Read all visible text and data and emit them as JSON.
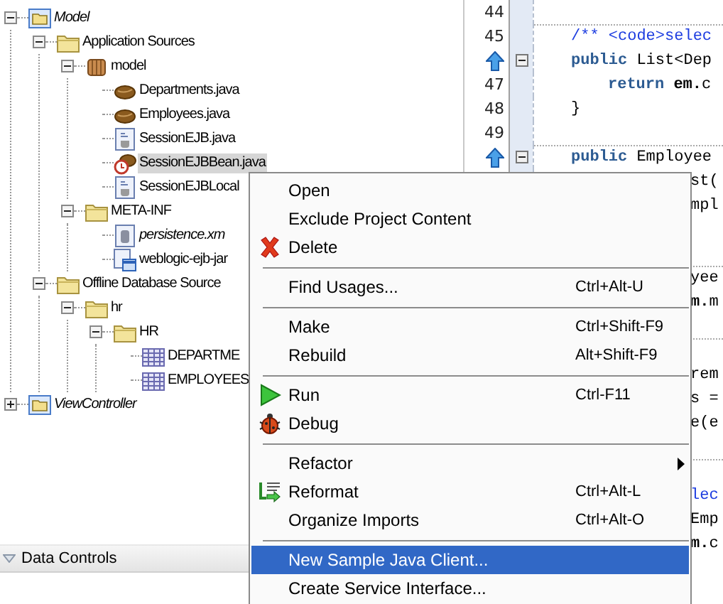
{
  "tree": [
    {
      "label": "Model",
      "kind": "project",
      "italic": true,
      "expanded": true,
      "selected": false,
      "children": [
        {
          "label": "Application Sources",
          "kind": "folder",
          "expanded": true,
          "selected": false,
          "children": [
            {
              "label": "model",
              "kind": "package",
              "expanded": true,
              "selected": false,
              "children": [
                {
                  "label": "Departments.java",
                  "kind": "entity",
                  "selected": false
                },
                {
                  "label": "Employees.java",
                  "kind": "entity",
                  "selected": false
                },
                {
                  "label": "SessionEJB.java",
                  "kind": "interface",
                  "selected": false
                },
                {
                  "label": "SessionEJBBean.java",
                  "kind": "bean",
                  "selected": true
                },
                {
                  "label": "SessionEJBLocal",
                  "kind": "interface",
                  "selected": false
                }
              ]
            },
            {
              "label": "META-INF",
              "kind": "folder",
              "expanded": true,
              "selected": false,
              "children": [
                {
                  "label": "persistence.xm",
                  "kind": "xml",
                  "italic": true,
                  "selected": false
                },
                {
                  "label": "weblogic-ejb-jar",
                  "kind": "descriptor",
                  "selected": false
                }
              ]
            }
          ]
        },
        {
          "label": "Offline Database Source",
          "kind": "folder",
          "expanded": true,
          "selected": false,
          "children": [
            {
              "label": "hr",
              "kind": "folder",
              "expanded": true,
              "selected": false,
              "children": [
                {
                  "label": "HR",
                  "kind": "folder",
                  "expanded": true,
                  "selected": false,
                  "children": [
                    {
                      "label": "DEPARTME",
                      "kind": "table",
                      "selected": false
                    },
                    {
                      "label": "EMPLOYEES",
                      "kind": "table",
                      "selected": false
                    }
                  ]
                }
              ]
            }
          ]
        }
      ]
    },
    {
      "label": "ViewController",
      "kind": "project",
      "italic": true,
      "expanded": false,
      "selected": false
    }
  ],
  "data_controls": {
    "title": "Data Controls"
  },
  "editor": {
    "lines": [
      {
        "kind": "numbered",
        "number": "44"
      },
      {
        "kind": "numbered",
        "number": "45",
        "separator_above": true,
        "tokens": [
          {
            "kind": "comment",
            "text": "/** <code>selec"
          }
        ]
      },
      {
        "kind": "override",
        "fold": true,
        "tokens": [
          {
            "kind": "keyword",
            "text": "public"
          },
          {
            "kind": "plain",
            "text": " List<Dep"
          }
        ]
      },
      {
        "kind": "numbered",
        "number": "47",
        "indented": true,
        "tokens": [
          {
            "kind": "keyword",
            "text": "return"
          },
          {
            "kind": "bold",
            "text": " em."
          },
          {
            "kind": "plain",
            "text": "c"
          }
        ]
      },
      {
        "kind": "numbered",
        "number": "48",
        "tokens": [
          {
            "kind": "plain",
            "text": "}"
          }
        ]
      },
      {
        "kind": "numbered",
        "number": "49"
      },
      {
        "kind": "override",
        "fold": true,
        "separator_above": true,
        "tokens": [
          {
            "kind": "keyword",
            "text": "public"
          },
          {
            "kind": "plain",
            "text": " Employee"
          }
        ]
      },
      {
        "kind": "partial",
        "tokens": [
          {
            "kind": "plain",
            "text": "st("
          }
        ]
      },
      {
        "kind": "partial",
        "tokens": [
          {
            "kind": "plain",
            "text": "mpl"
          }
        ]
      },
      {
        "kind": "partial"
      },
      {
        "kind": "partial"
      },
      {
        "kind": "partial",
        "separator_above": true,
        "tokens": [
          {
            "kind": "plain",
            "text": "yee"
          }
        ]
      },
      {
        "kind": "partial",
        "tokens": [
          {
            "kind": "bold",
            "text": "m."
          },
          {
            "kind": "plain",
            "text": "m"
          }
        ]
      },
      {
        "kind": "partial"
      },
      {
        "kind": "partial",
        "separator_above": true
      },
      {
        "kind": "partial",
        "tokens": [
          {
            "kind": "plain",
            "text": "rem"
          }
        ]
      },
      {
        "kind": "partial",
        "tokens": [
          {
            "kind": "plain",
            "text": "s ="
          }
        ]
      },
      {
        "kind": "partial",
        "tokens": [
          {
            "kind": "plain",
            "text": "e(e"
          }
        ]
      },
      {
        "kind": "partial"
      },
      {
        "kind": "partial",
        "separator_above": true
      },
      {
        "kind": "partial",
        "tokens": [
          {
            "kind": "comment",
            "text": "lec"
          }
        ]
      },
      {
        "kind": "partial",
        "tokens": [
          {
            "kind": "plain",
            "text": "Emp"
          }
        ]
      },
      {
        "kind": "partial",
        "tokens": [
          {
            "kind": "bold",
            "text": "m."
          },
          {
            "kind": "plain",
            "text": "c"
          }
        ]
      }
    ]
  },
  "context_menu": {
    "items": [
      {
        "kind": "plain",
        "label": "Open",
        "selected": false
      },
      {
        "kind": "plain",
        "label": "Exclude Project Content",
        "selected": false
      },
      {
        "kind": "delete",
        "label": "Delete",
        "selected": false
      },
      {
        "kind": "separator"
      },
      {
        "kind": "plain",
        "label": "Find Usages...",
        "shortcut": "Ctrl+Alt-U",
        "selected": false
      },
      {
        "kind": "separator"
      },
      {
        "kind": "plain",
        "label": "Make",
        "shortcut": "Ctrl+Shift-F9",
        "selected": false
      },
      {
        "kind": "plain",
        "label": "Rebuild",
        "shortcut": "Alt+Shift-F9",
        "selected": false
      },
      {
        "kind": "separator"
      },
      {
        "kind": "run",
        "label": "Run",
        "shortcut": "Ctrl-F11",
        "selected": false
      },
      {
        "kind": "debug",
        "label": "Debug",
        "selected": false
      },
      {
        "kind": "separator"
      },
      {
        "kind": "plain",
        "label": "Refactor",
        "submenu": true,
        "selected": false
      },
      {
        "kind": "reformat",
        "label": "Reformat",
        "shortcut": "Ctrl+Alt-L",
        "selected": false
      },
      {
        "kind": "plain",
        "label": "Organize Imports",
        "shortcut": "Ctrl+Alt-O",
        "selected": false
      },
      {
        "kind": "separator"
      },
      {
        "kind": "plain",
        "label": "New Sample Java Client...",
        "selected": true
      },
      {
        "kind": "plain",
        "label": "Create Service Interface...",
        "selected": false
      }
    ]
  }
}
